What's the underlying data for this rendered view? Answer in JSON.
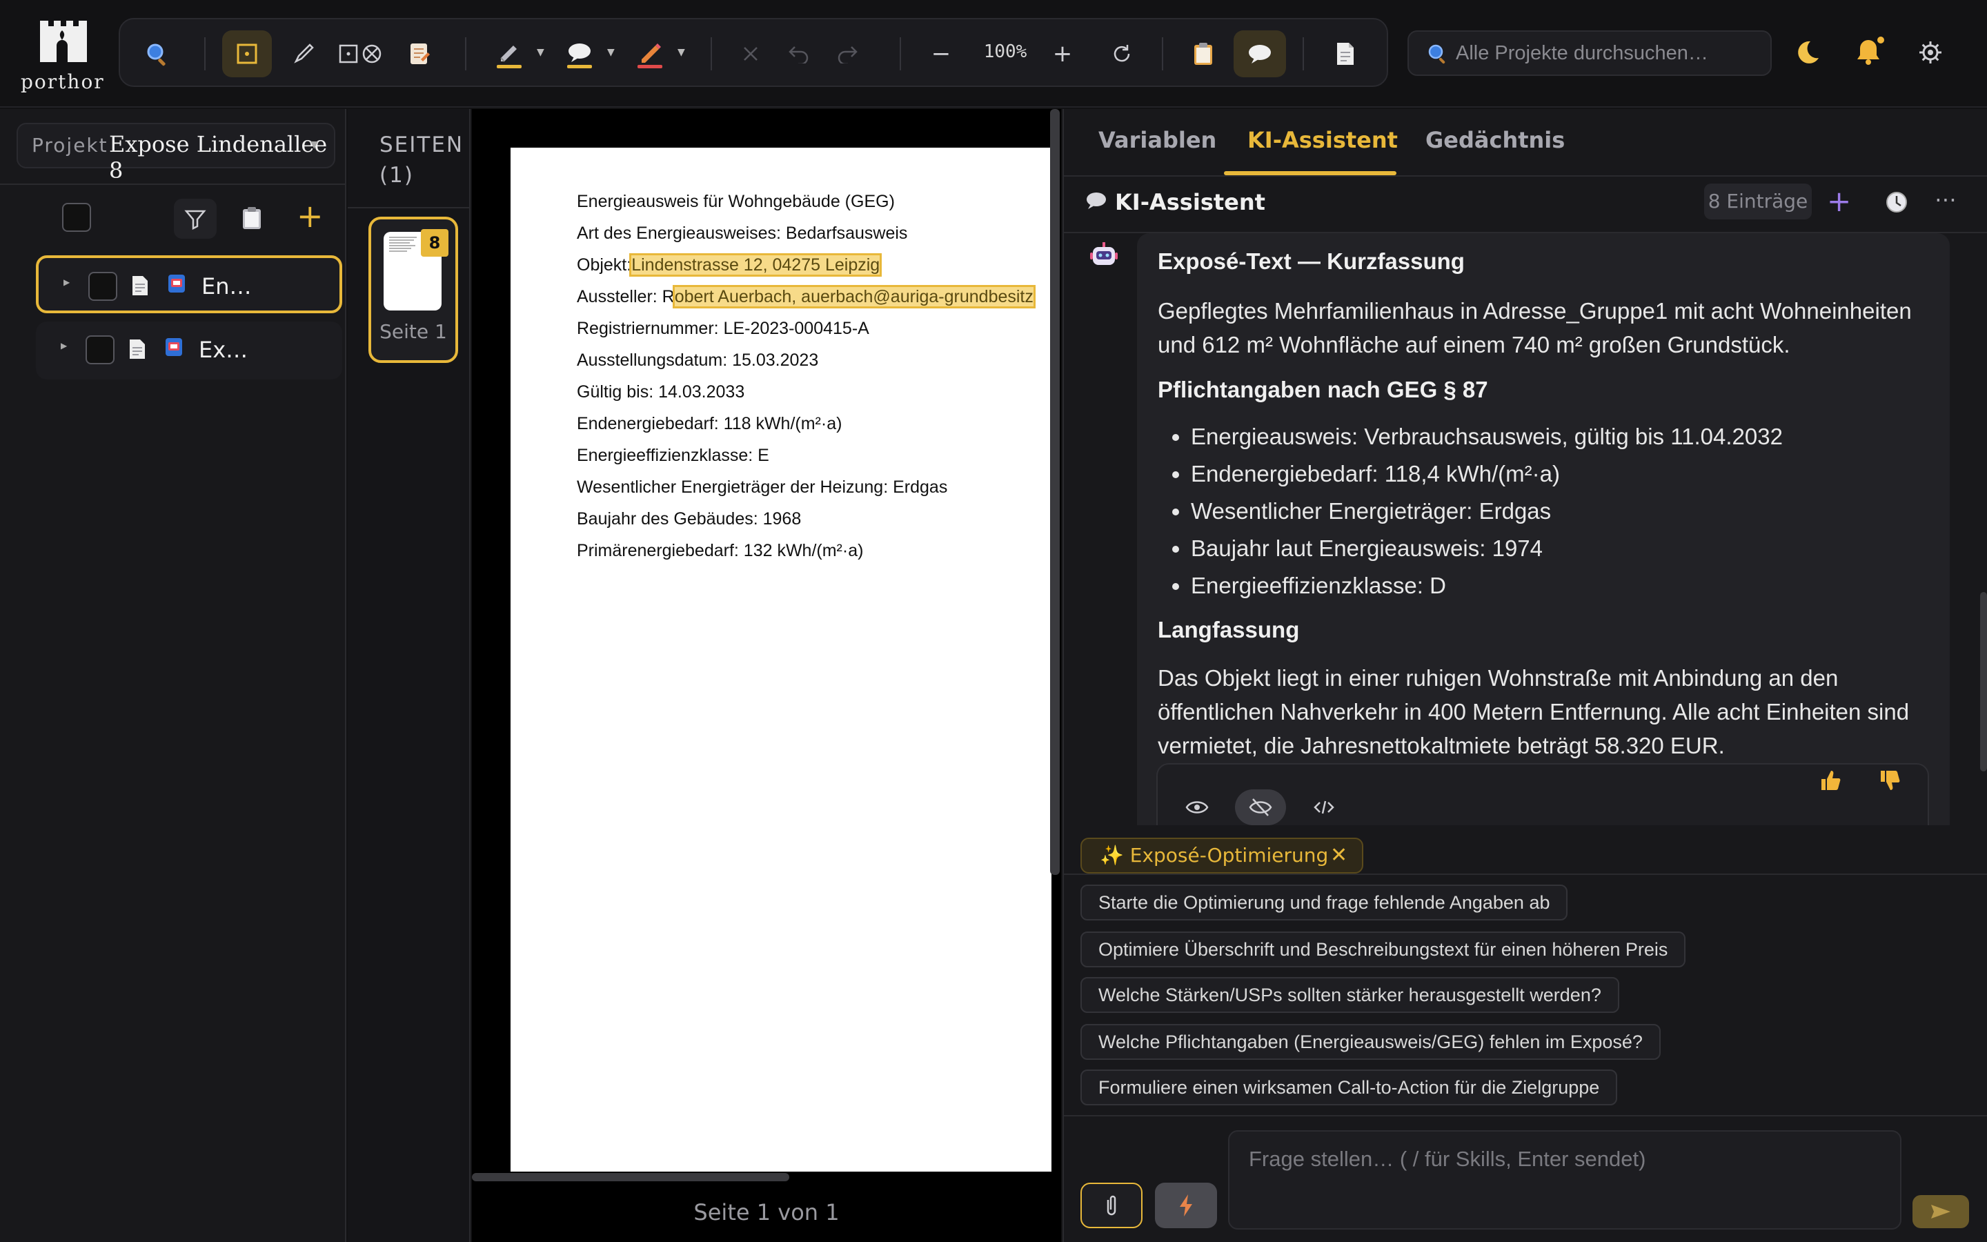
{
  "app": {
    "logo_text": "porthor"
  },
  "toolbar": {
    "zoom": "100%",
    "zoom_out": "−",
    "zoom_in": "+"
  },
  "search": {
    "placeholder": "Alle Projekte durchsuchen…"
  },
  "sidebar": {
    "project_label": "Projekt",
    "project_name": "Expose Lindenallee 8",
    "items": [
      {
        "label": "En…",
        "selected": true
      },
      {
        "label": "Ex…",
        "selected": false
      }
    ]
  },
  "pages": {
    "title": "SEITEN (1)",
    "thumb_badge": "8",
    "thumb_label": "Seite 1"
  },
  "document": {
    "lines": [
      "Energieausweis für Wohngebäude (GEG)",
      "Art des Energieausweises: Bedarfsausweis",
      "Registriernummer: LE-2023-000415-A",
      "Ausstellungsdatum: 15.03.2023",
      "Gültig bis: 14.03.2033",
      "Endenergiebedarf: 118 kWh/(m²·a)",
      "Energieeffizienzklasse: E",
      "Wesentlicher Energieträger der Heizung: Erdgas",
      "Baujahr des Gebäudes: 1968",
      "Primärenergiebedarf: 132 kWh/(m²·a)"
    ],
    "objekt_label": "Objekt:",
    "objekt_value": "Lindenstrasse 12, 04275 Leipzig",
    "aussteller_label": "Aussteller: R",
    "aussteller_value": "obert Auerbach, auerbach@auriga-grundbesitz",
    "footer": "Seite 1 von 1"
  },
  "right_panel": {
    "tabs": [
      "Variablen",
      "KI-Assistent",
      "Gedächtnis"
    ],
    "active_tab": "KI-Assistent",
    "header_title": "KI-Assistent",
    "entries": "8 Einträge",
    "message": {
      "h1": "Exposé-Text — Kurzfassung",
      "p1": "Gepflegtes Mehrfamilienhaus in Adresse_Gruppe1 mit acht Wohneinheiten und 612 m² Wohnfläche auf einem 740 m² großen Grundstück.",
      "h2": "Pflichtangaben nach GEG § 87",
      "bullets": [
        "Energieausweis: Verbrauchsausweis, gültig bis 11.04.2032",
        "Endenergiebedarf: 118,4 kWh/(m²·a)",
        "Wesentlicher Energieträger: Erdgas",
        "Baujahr laut Energieausweis: 1974",
        "Energieeffizienzklasse: D"
      ],
      "h3": "Langfassung",
      "p2": "Das Objekt liegt in einer ruhigen Wohnstraße mit Anbindung an den öffentlichen Nahverkehr in 400 Metern Entfernung. Alle acht Einheiten sind vermietet, die Jahresnettokaltmiete beträgt 58.320 EUR."
    },
    "skill_chip": "✨ Exposé-Optimierung",
    "suggestions": [
      "Starte die Optimierung und frage fehlende Angaben ab",
      "Optimiere Überschrift und Beschreibungstext für einen höheren Preis",
      "Welche Stärken/USPs sollten stärker herausgestellt werden?",
      "Welche Pflichtangaben (Energieausweis/GEG) fehlen im Exposé?",
      "Formuliere einen wirksamen Call-to-Action für die Zielgruppe"
    ],
    "input_placeholder": "Frage stellen… ( / für Skills, Enter sendet)"
  },
  "colors": {
    "accent": "#e8b83a",
    "background": "#121214",
    "purple": "#9b7be8"
  }
}
